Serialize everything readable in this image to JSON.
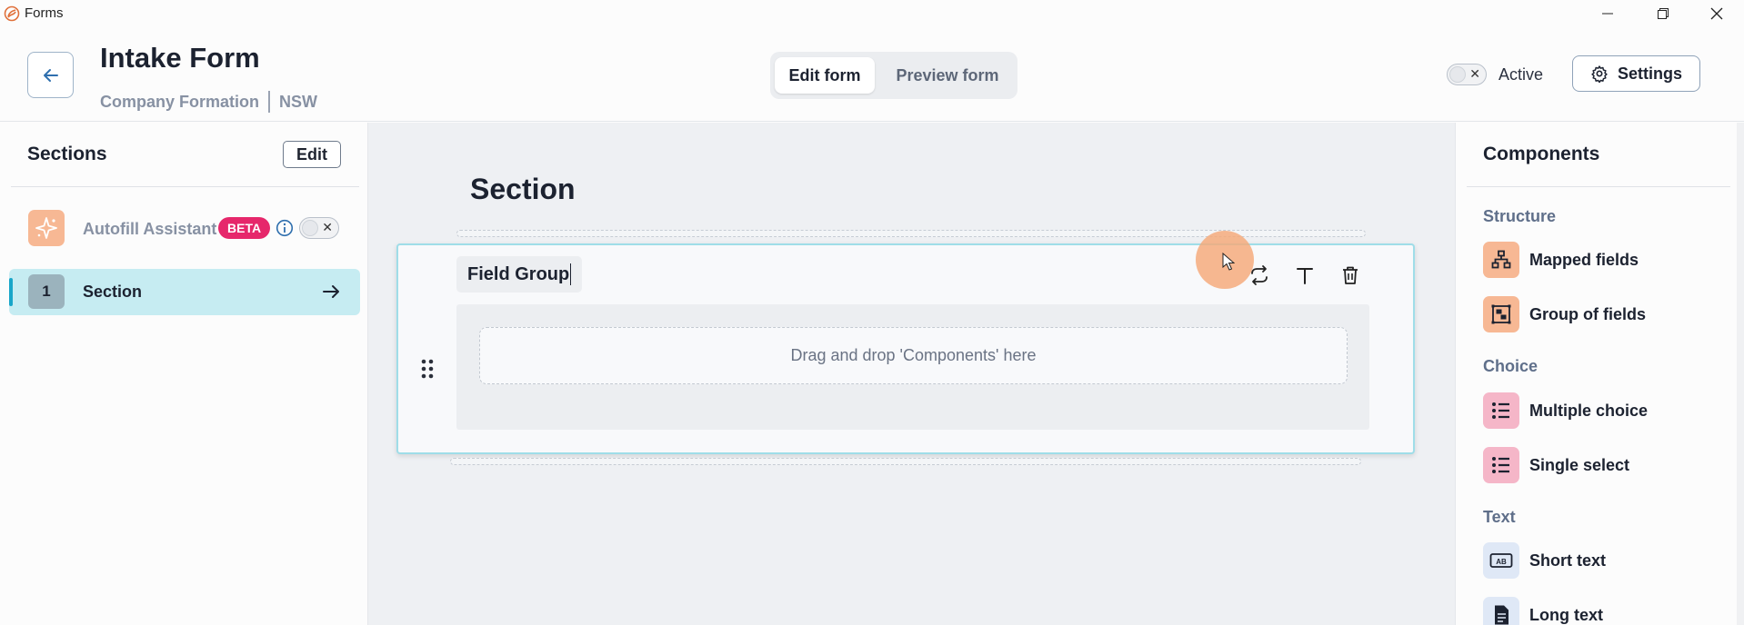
{
  "window": {
    "title": "Forms"
  },
  "header": {
    "title": "Intake Form",
    "subtitle_left": "Company Formation",
    "subtitle_right": "NSW",
    "tabs": {
      "edit": "Edit form",
      "preview": "Preview form"
    },
    "active_label": "Active",
    "settings_label": "Settings"
  },
  "sidebar": {
    "heading": "Sections",
    "edit_label": "Edit",
    "autofill": {
      "label": "Autofill Assistant",
      "badge": "BETA"
    },
    "sections": [
      {
        "number": "1",
        "label": "Section"
      }
    ]
  },
  "canvas": {
    "section_title": "Section",
    "group": {
      "label": "Field Group",
      "drop_hint": "Drag and drop 'Components' here"
    }
  },
  "components": {
    "heading": "Components",
    "categories": [
      {
        "name": "Structure",
        "items": [
          {
            "label": "Mapped fields",
            "icon": "sitemap-icon"
          },
          {
            "label": "Group of fields",
            "icon": "group-icon"
          }
        ]
      },
      {
        "name": "Choice",
        "items": [
          {
            "label": "Multiple choice",
            "icon": "list-icon"
          },
          {
            "label": "Single select",
            "icon": "list-icon"
          }
        ]
      },
      {
        "name": "Text",
        "items": [
          {
            "label": "Short text",
            "icon": "short-text-icon"
          },
          {
            "label": "Long text",
            "icon": "document-icon"
          }
        ]
      }
    ]
  },
  "colors": {
    "accent": "#19a6c9",
    "selected_bg": "#c6ecf2",
    "beta": "#e6276b",
    "structure": "#f7b894",
    "choice": "#f5b6c8",
    "text": "#dfe8f6"
  }
}
